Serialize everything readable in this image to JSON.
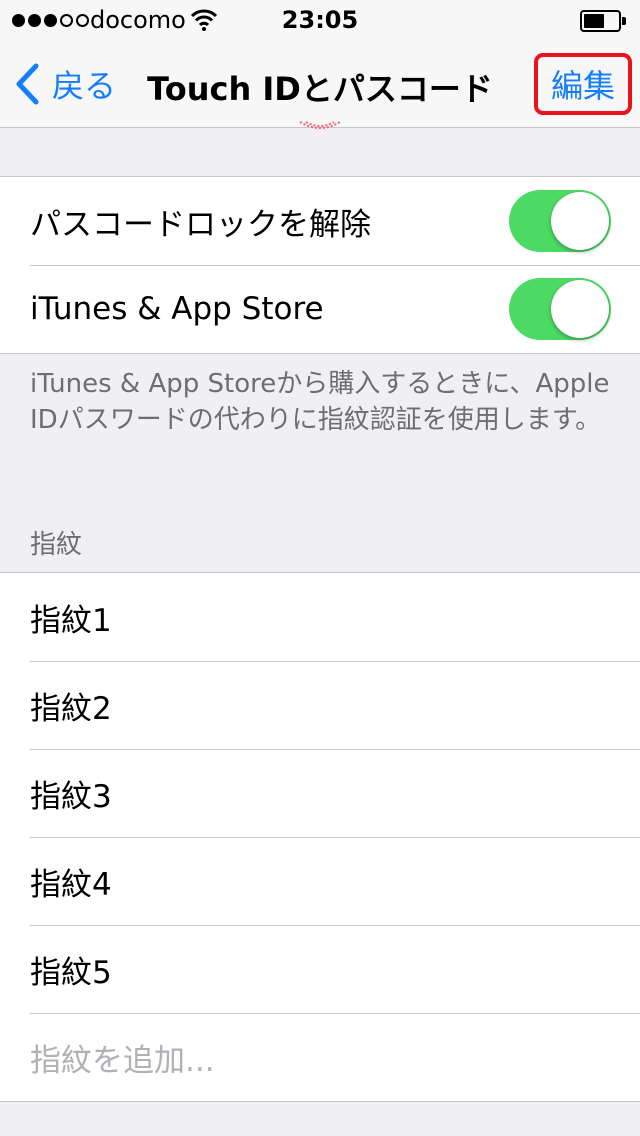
{
  "status_bar": {
    "carrier": "docomo",
    "time": "23:05",
    "signal_bars_filled": 3,
    "signal_bars_total": 5,
    "battery_level": 0.55
  },
  "nav": {
    "back_label": "戻る",
    "title": "Touch IDとパスコード",
    "edit_label": "編集",
    "highlight_color": "#e8131b",
    "tint_color": "#147efb"
  },
  "toggles_group": {
    "items": [
      {
        "label": "パスコードロックを解除",
        "on": true
      },
      {
        "label": "iTunes & App Store",
        "on": true
      }
    ],
    "footer": "iTunes & App Storeから購入するときに、Apple IDパスワードの代わりに指紋認証を使用します。",
    "toggle_color": "#4cd964"
  },
  "fingerprints": {
    "header": "指紋",
    "items": [
      "指紋1",
      "指紋2",
      "指紋3",
      "指紋4",
      "指紋5"
    ],
    "add_label": "指紋を追加..."
  }
}
